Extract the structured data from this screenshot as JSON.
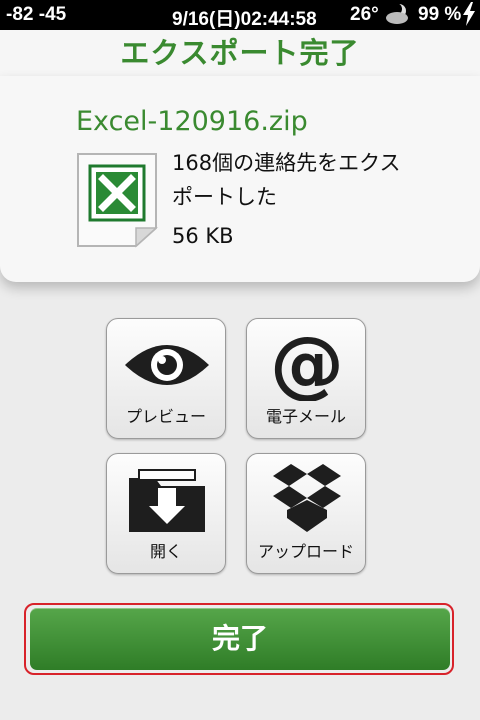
{
  "status_bar": {
    "signal": "-82 -45",
    "time": "9/16(日)02:44:58",
    "temperature": "26°",
    "weather_icon": "cloudy-moon-icon",
    "battery": "99 %",
    "charging_icon": "bolt-icon"
  },
  "title": "エクスポート完了",
  "file": {
    "name": "Excel-120916.zip",
    "icon": "excel-file-icon",
    "message": "168個の連絡先をエクスポートした",
    "size": "56 KB"
  },
  "actions": [
    {
      "label": "プレビュー",
      "icon": "eye-icon"
    },
    {
      "label": "電子メール",
      "icon": "at-sign-icon"
    },
    {
      "label": "開く",
      "icon": "folder-download-icon"
    },
    {
      "label": "アップロード",
      "icon": "dropbox-icon"
    }
  ],
  "done_label": "完了",
  "colors": {
    "accent_green": "#3a8a30",
    "button_green": "#2f7d27",
    "highlight_red": "#d8222a"
  }
}
